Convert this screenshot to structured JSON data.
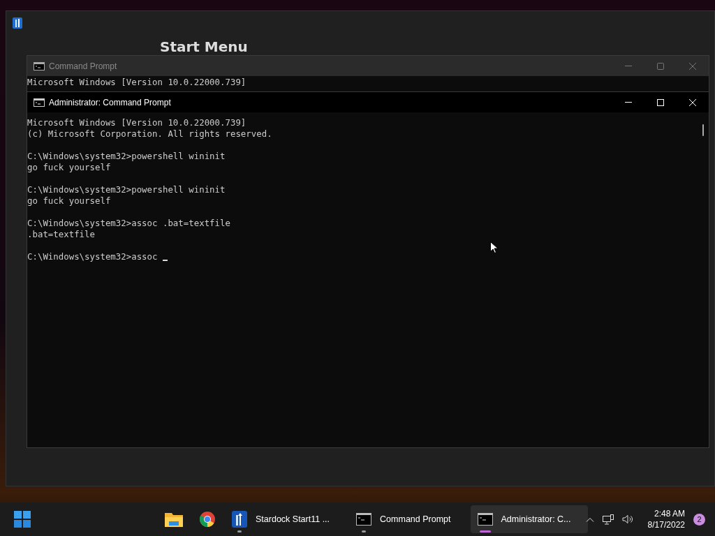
{
  "desktop_window": {
    "title": "Start Menu"
  },
  "background_console": {
    "title": "Command Prompt",
    "lines": [
      "Microsoft Windows [Version 10.0.22000.739]"
    ]
  },
  "console": {
    "title": "Administrator: Command Prompt",
    "blocks": [
      [
        "Microsoft Windows [Version 10.0.22000.739]",
        "(c) Microsoft Corporation. All rights reserved."
      ],
      [
        "C:\\Windows\\system32>powershell wininit",
        "go fuck yourself"
      ],
      [
        "C:\\Windows\\system32>powershell wininit",
        "go fuck yourself"
      ],
      [
        "C:\\Windows\\system32>assoc .bat=textfile",
        ".bat=textfile"
      ],
      [
        "C:\\Windows\\system32>assoc "
      ]
    ]
  },
  "taskbar": {
    "apps": [
      {
        "kind": "folder",
        "running": false,
        "selected": false
      },
      {
        "kind": "browser",
        "running": false,
        "selected": false
      },
      {
        "kind": "start11",
        "label": "Stardock Start11 ...",
        "running": true,
        "selected": false
      },
      {
        "kind": "console",
        "label": "Command Prompt",
        "running": true,
        "selected": false
      },
      {
        "kind": "console",
        "label": "Administrator: C...",
        "running": true,
        "selected": true
      }
    ],
    "time": "2:48 AM",
    "date": "8/17/2022",
    "notifications": "2"
  }
}
